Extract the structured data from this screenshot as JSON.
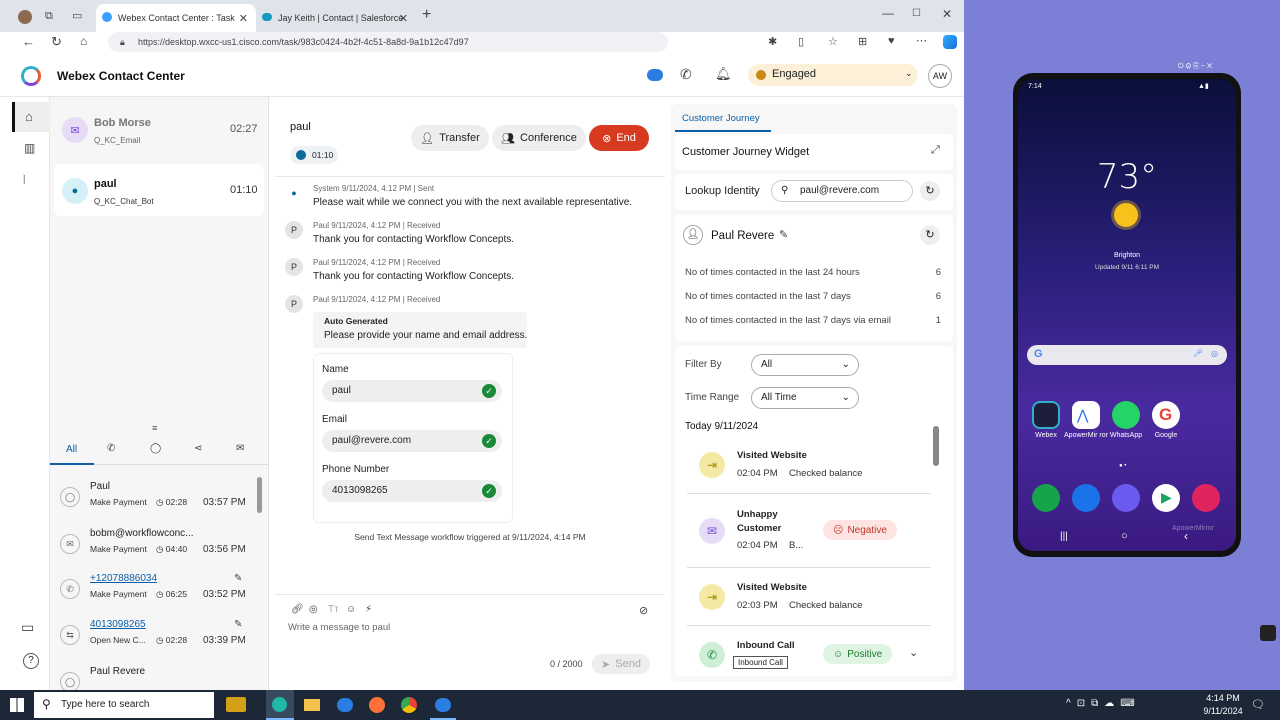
{
  "browser": {
    "tabs": [
      {
        "label": "Webex Contact Center : Task"
      },
      {
        "label": "Jay Keith | Contact | Salesforce"
      }
    ],
    "url": "https://desktop.wxcc-us1.cisco.com/task/983c0424-4b2f-4c51-8a8d-9a1b12c47d97"
  },
  "app": {
    "title": "Webex Contact Center",
    "status": "Engaged",
    "user_initials": "AW"
  },
  "tasks": [
    {
      "name": "Bob Morse",
      "queue": "Q_KC_Email",
      "time": "02:27"
    },
    {
      "name": "paul",
      "queue": "Q_KC_Chat_Bot",
      "time": "01:10"
    }
  ],
  "history": {
    "tab_all": "All",
    "items": [
      {
        "title": "Paul",
        "subtitle": "Make Payment",
        "duration": "02:28",
        "time": "03:57 PM"
      },
      {
        "title": "bobm@workflowconc...",
        "subtitle": "Make Payment",
        "duration": "04:40",
        "time": "03:56 PM"
      },
      {
        "title": "+12078886034",
        "subtitle": "Make Payment",
        "duration": "06:25",
        "time": "03:52 PM"
      },
      {
        "title": "4013098265",
        "subtitle": "Open New C...",
        "duration": "02:28",
        "time": "03:39 PM"
      },
      {
        "title": "Paul Revere",
        "subtitle": "",
        "duration": "",
        "time": ""
      }
    ]
  },
  "chat": {
    "contact": "paul",
    "timer": "01:10",
    "transfer_label": "Transfer",
    "conference_label": "Conference",
    "end_label": "End",
    "messages": [
      {
        "avatar": "",
        "meta": "System     9/11/2024, 4:12 PM | Sent",
        "text": "Please wait while we connect you with the next available representative."
      },
      {
        "avatar": "P",
        "meta": "Paul     9/11/2024, 4:12 PM | Received",
        "text": "Thank you for contacting Workflow Concepts."
      },
      {
        "avatar": "P",
        "meta": "Paul     9/11/2024, 4:12 PM | Received",
        "text": "Thank you for contacting Workflow Concepts."
      },
      {
        "avatar": "P",
        "meta": "Paul     9/11/2024, 4:12 PM | Received",
        "text": ""
      }
    ],
    "auto_generated_label": "Auto Generated",
    "auto_generated_text": "Please provide your name and email address.",
    "form": {
      "name_label": "Name",
      "name_value": "paul",
      "email_label": "Email",
      "email_value": "paul@revere.com",
      "phone_label": "Phone Number",
      "phone_value": "4013098265"
    },
    "workflow_note": "Send Text Message workflow triggered at 9/11/2024, 4:14 PM",
    "input_placeholder": "Write a message to paul",
    "char_count": "0 / 2000",
    "send_label": "Send"
  },
  "journey": {
    "tab": "Customer Journey",
    "widget_title": "Customer Journey Widget",
    "lookup_label": "Lookup Identity",
    "lookup_value": "paul@revere.com",
    "customer_name": "Paul Revere",
    "stats": [
      {
        "label": "No of times contacted in the last 24 hours",
        "value": "6"
      },
      {
        "label": "No of times contacted in the last 7 days",
        "value": "6"
      },
      {
        "label": "No of times contacted in the last 7 days via email",
        "value": "1"
      }
    ],
    "filter_by_label": "Filter By",
    "filter_by_value": "All",
    "time_range_label": "Time Range",
    "time_range_value": "All Time",
    "day_label": "Today  9/11/2024",
    "events": [
      {
        "title": "Visited Website",
        "time": "02:04 PM",
        "detail": "Checked balance",
        "badge": "",
        "color": "#f3e9a3"
      },
      {
        "title": "Unhappy Customer",
        "time": "02:04 PM",
        "detail": "B...",
        "badge": "Negative",
        "color": "#e6dcf5"
      },
      {
        "title": "Visited Website",
        "time": "02:03 PM",
        "detail": "Checked balance",
        "badge": "",
        "color": "#f3e9a3"
      },
      {
        "title": "Inbound Call",
        "time": "",
        "detail": "",
        "badge": "Positive",
        "color": "#cfeed6"
      }
    ],
    "tooltip": "Inbound Call"
  },
  "taskbar": {
    "search_placeholder": "Type here to search",
    "clock_time": "4:14 PM",
    "clock_date": "9/11/2024"
  },
  "phone": {
    "clock": "7:14",
    "temperature": "73°",
    "location": "Brighton",
    "updated": "Updated 9/11 6:11 PM",
    "apps": [
      {
        "label": "Webex",
        "color": "#1e1e3a"
      },
      {
        "label": "ApowerMir ror",
        "color": "#2b6de8"
      },
      {
        "label": "WhatsApp",
        "color": "#25d366"
      },
      {
        "label": "Google",
        "color": "#ffffff"
      }
    ],
    "dock": [
      {
        "color": "#16a34a"
      },
      {
        "color": "#1a73e8"
      },
      {
        "color": "#6a5af0"
      },
      {
        "color": "#ffffff"
      },
      {
        "color": "#e0245e"
      }
    ],
    "watermark": "ApowerMirror"
  }
}
